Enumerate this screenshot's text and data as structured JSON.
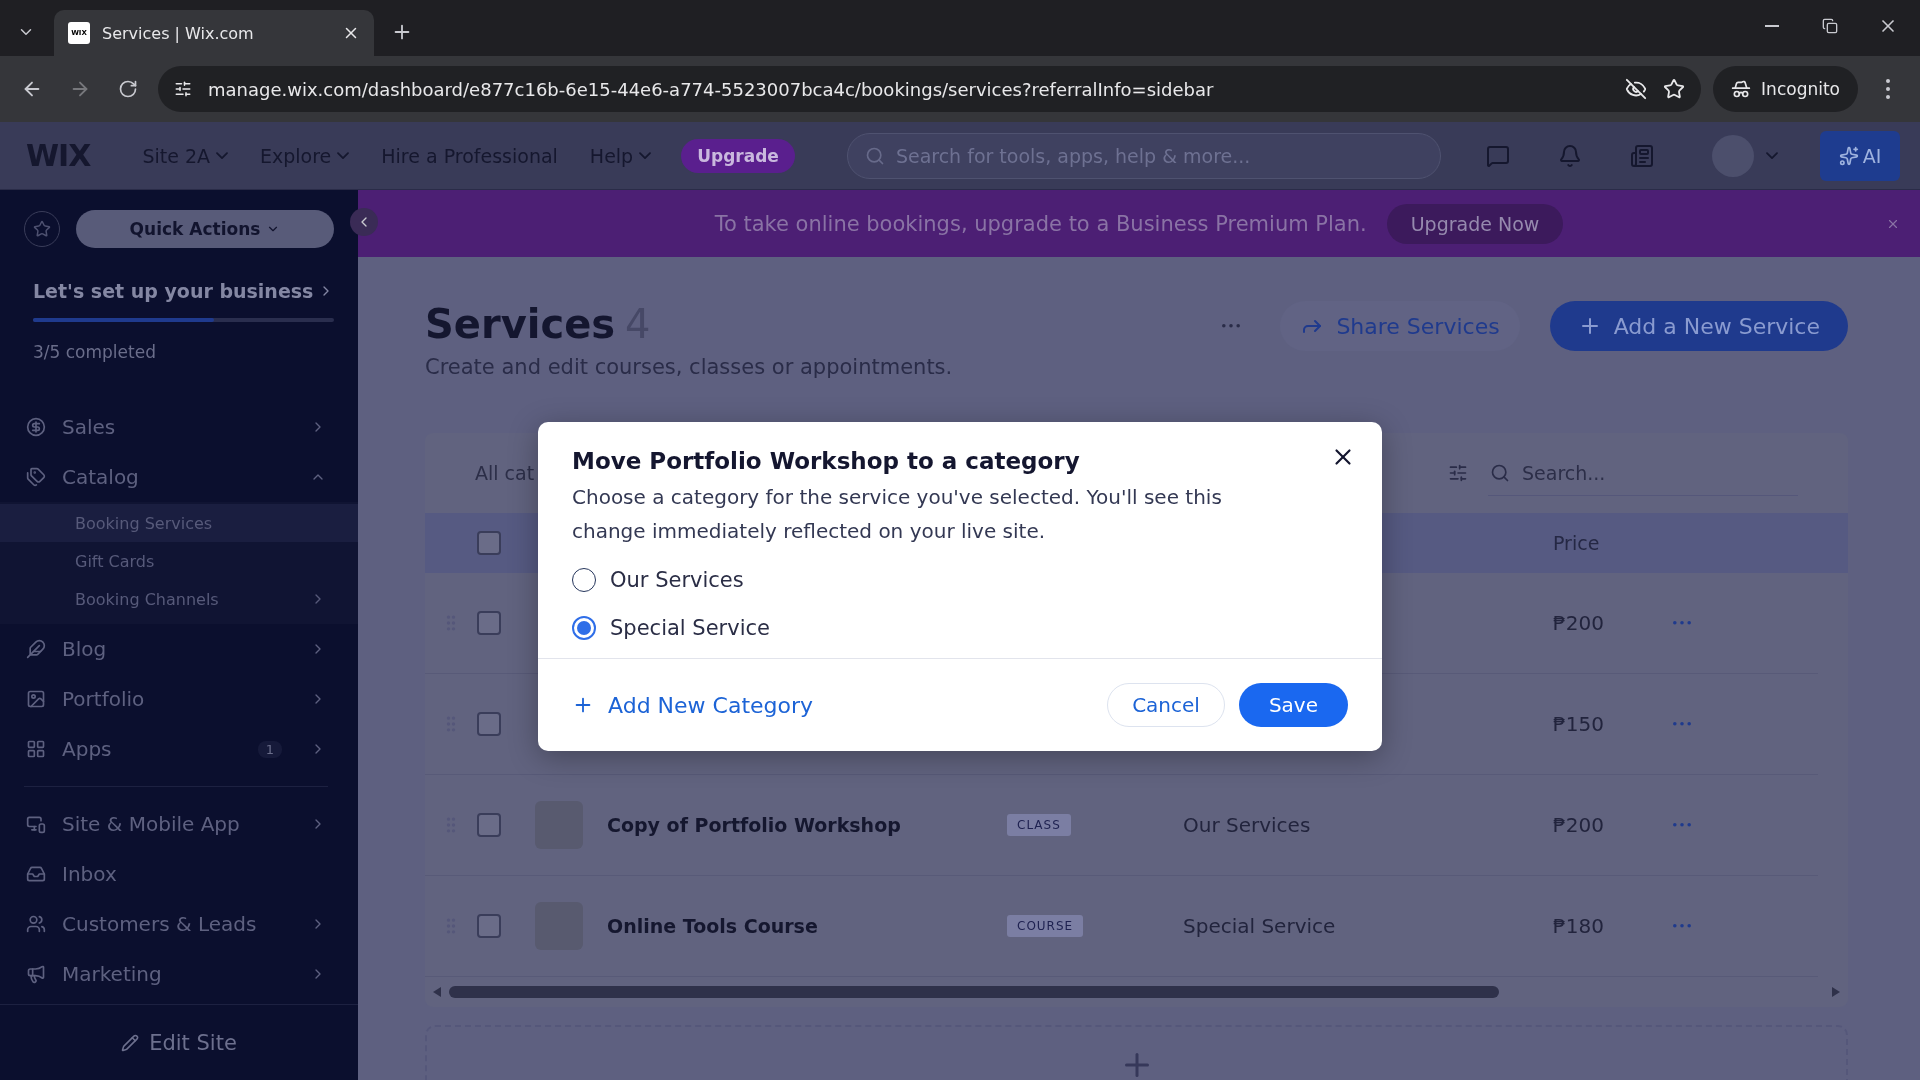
{
  "browser": {
    "tabs": [
      {
        "title": "Services | Wix.com",
        "favicon": "WIX",
        "selected": true
      }
    ],
    "url": "manage.wix.com/dashboard/e877c16b-6e15-44e6-a774-5523007bca4c/bookings/services?referralInfo=sidebar",
    "profile": "Incognito"
  },
  "topbar": {
    "logo": "WIX",
    "site": "Site 2A",
    "nav": [
      {
        "label": "Explore",
        "menu": true
      },
      {
        "label": "Hire a Professional",
        "menu": false
      },
      {
        "label": "Help",
        "menu": true
      }
    ],
    "upgrade": "Upgrade",
    "search": {
      "placeholder": "Search for tools, apps, help & more..."
    },
    "ai": "AI"
  },
  "sidebar": {
    "quick_actions": "Quick Actions",
    "setup": {
      "title": "Let's set up your business",
      "level": 0.6,
      "progress": "3/5 completed"
    },
    "groups": [
      {
        "items": [
          {
            "label": "Sales",
            "arrow": true,
            "expanded": false
          },
          {
            "label": "Catalog",
            "arrow": true,
            "expanded": true,
            "children": [
              {
                "label": "Booking Services",
                "selected": true,
                "arrow": false
              },
              {
                "label": "Gift Cards",
                "selected": false,
                "arrow": false
              },
              {
                "label": "Booking Channels",
                "selected": false,
                "arrow": true
              }
            ]
          },
          {
            "label": "Blog",
            "arrow": true,
            "expanded": false
          },
          {
            "label": "Portfolio",
            "arrow": true,
            "expanded": false
          },
          {
            "label": "Apps",
            "arrow": true,
            "expanded": false,
            "badge": "1"
          }
        ]
      },
      {
        "items": [
          {
            "label": "Site & Mobile App",
            "arrow": true,
            "expanded": false
          },
          {
            "label": "Inbox",
            "arrow": false
          },
          {
            "label": "Customers & Leads",
            "arrow": true,
            "expanded": false
          },
          {
            "label": "Marketing",
            "arrow": true,
            "expanded": false
          }
        ]
      }
    ],
    "edit_site": "Edit Site"
  },
  "banner": {
    "text": "To take online bookings, upgrade to a Business Premium Plan.",
    "button": "Upgrade Now"
  },
  "page": {
    "title": "Services",
    "count": "4",
    "subtitle": "Create and edit courses, classes or appointments.",
    "share": "Share Services",
    "add": "Add a New Service"
  },
  "table": {
    "filter": "All cat",
    "search": {
      "placeholder": "Search..."
    },
    "select_all_checked": false,
    "price_header": "Price",
    "rows": [
      {
        "name": "",
        "type": "",
        "category": "",
        "price": "₱200",
        "checked": false
      },
      {
        "name": "",
        "type": "",
        "category": "",
        "price": "₱150",
        "checked": false
      },
      {
        "name": "Copy of Portfolio Workshop",
        "type": "CLASS",
        "category": "Our Services",
        "price": "₱200",
        "checked": false
      },
      {
        "name": "Online Tools Course",
        "type": "COURSE",
        "category": "Special Service",
        "price": "₱180",
        "checked": false
      }
    ]
  },
  "modal": {
    "title": "Move Portfolio Workshop to a category",
    "text": "Choose a category for the service you've selected. You'll see this change immediately reflected on your live site.",
    "options": [
      {
        "label": "Our Services",
        "selected": false
      },
      {
        "label": "Special Service",
        "selected": true
      }
    ],
    "add_category": "Add New Category",
    "cancel": "Cancel",
    "save": "Save"
  }
}
